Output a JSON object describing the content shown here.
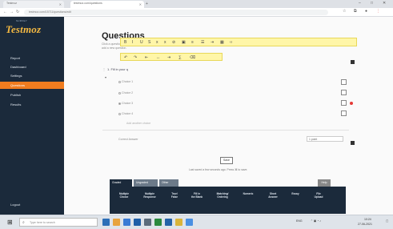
{
  "browser": {
    "tabs": [
      {
        "label": "Testmoz"
      },
      {
        "label": "testmoz.com/questions"
      }
    ],
    "new_tab": "+",
    "window_controls": [
      "–",
      "□",
      "✕"
    ],
    "address": "testmoz.com/15711/questions/edit",
    "toolbar_icons": [
      "star-icon",
      "extension-icon",
      "profile-icon",
      "menu-icon"
    ]
  },
  "sidebar": {
    "logo_top": "SURVEY",
    "logo": "Testmoz",
    "items": [
      {
        "label": "Report"
      },
      {
        "label": "Dashboard"
      },
      {
        "label": "Settings"
      },
      {
        "label": "Questions",
        "active": true
      },
      {
        "label": "Publish"
      },
      {
        "label": "Results"
      }
    ],
    "logout": "Logout"
  },
  "main": {
    "title": "Questions",
    "intro_lines": [
      "Click a question to edit it. Use the buttons below to",
      "add a new question."
    ],
    "toolbar1_icons": [
      "bold-icon",
      "italic-icon",
      "underline-icon",
      "strike-icon",
      "sub-icon",
      "sup-icon",
      "link-icon",
      "image-icon",
      "list-icon",
      "list-ol-icon",
      "indent-icon",
      "table-icon",
      "code-icon"
    ],
    "toolbar2_icons": [
      "undo-icon",
      "redo-icon",
      "align-left-icon",
      "align-center-icon",
      "align-right-icon",
      "formula-icon",
      "eraser-icon"
    ],
    "question_label": "1. Fill in your q",
    "options": [
      {
        "label": "Choice 1",
        "selected": false
      },
      {
        "label": "Choice 2",
        "selected": false
      },
      {
        "label": "Choice 3",
        "selected": true
      },
      {
        "label": "Choice 4",
        "selected": false
      }
    ],
    "add_option": "Add another choice",
    "hint": "Correct Answer",
    "points": "1 point",
    "save_label": "Save",
    "save_note": "Last saved a few seconds ago. Press ⌘ to save."
  },
  "type_tabs": [
    {
      "label": "Graded",
      "active": true
    },
    {
      "label": "Ungraded",
      "active": false
    },
    {
      "label": "Other",
      "active": false
    }
  ],
  "help_label": "Help",
  "question_types": [
    {
      "line1": "Multiple",
      "line2": "Choice"
    },
    {
      "line1": "Multiple",
      "line2": "Response"
    },
    {
      "line1": "True/",
      "line2": "False"
    },
    {
      "line1": "Fill in",
      "line2": "the Blank"
    },
    {
      "line1": "Matching/",
      "line2": "Ordering"
    },
    {
      "line1": "Numeric",
      "line2": ""
    },
    {
      "line1": "Short",
      "line2": "Answer"
    },
    {
      "line1": "Essay",
      "line2": ""
    },
    {
      "line1": "File",
      "line2": "Upload"
    }
  ],
  "taskbar": {
    "search_placeholder": "Type here to search",
    "tray_text": "ENG",
    "time": "10:24",
    "date": "27-06-2021"
  }
}
